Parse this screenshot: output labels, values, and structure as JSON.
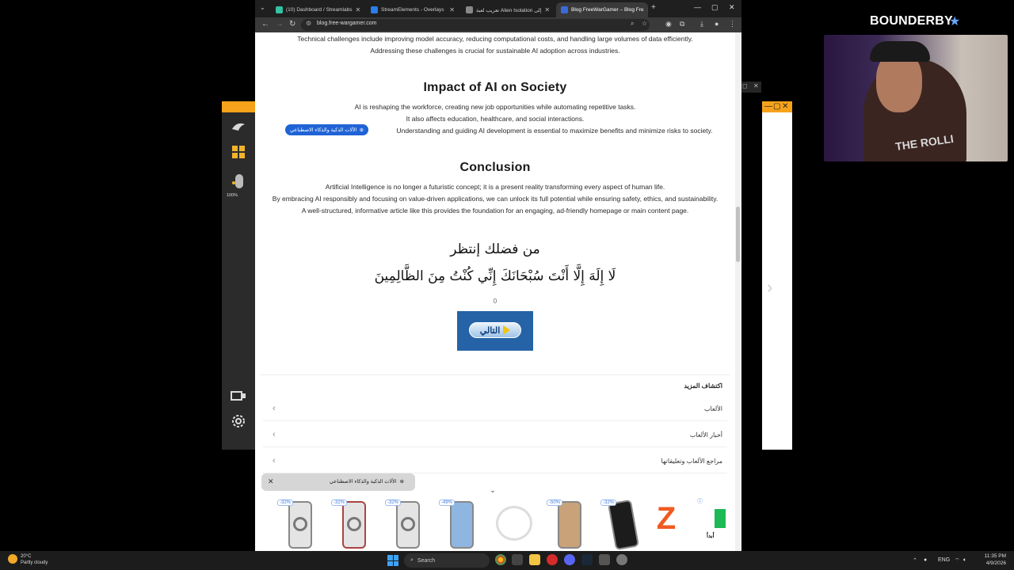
{
  "browser": {
    "tabs": [
      {
        "label": "(10) Dashboard / Streamlabs",
        "fav_color": "#31c3a2"
      },
      {
        "label": "StreamElements - Overlays",
        "fav_color": "#2b7de9"
      },
      {
        "label": "تعريب لعبة Alien Isolation إلى",
        "fav_color": "#888888"
      },
      {
        "label": "Blog FreeWarGamer – Blog Fre",
        "fav_color": "#3b6ad8"
      }
    ],
    "url": "blog.free-wargamer.com"
  },
  "article": {
    "intro_lines": [
      "Technical challenges include improving model accuracy, reducing computational costs, and handling large volumes of data efficiently.",
      "Addressing these challenges is crucial for sustainable AI adoption across industries."
    ],
    "impact_heading": "Impact of AI on Society",
    "impact_lines": [
      "AI is reshaping the workforce, creating new job opportunities while automating repetitive tasks.",
      "It also affects education, healthcare, and social interactions.",
      "Understanding and guiding AI development is essential to maximize benefits and minimize risks to society."
    ],
    "chip_label": "الآلات الذكية والذكاء الاصطناعي",
    "conclusion_heading": "Conclusion",
    "conclusion_lines": [
      "Artificial Intelligence is no longer a futuristic concept; it is a present reality transforming every aspect of human life.",
      "By embracing AI responsibly and focusing on value-driven applications, we can unlock its full potential while ensuring safety, ethics, and sustainability.",
      "A well-structured, informative article like this provides the foundation for an engaging, ad-friendly homepage or main content page."
    ]
  },
  "wait": {
    "please_wait": "من فضلك إنتظر",
    "dua": "لَا إِلَهَ إِلَّا أَنْتَ سُبْحَانَكَ إِنِّي كُنْتُ مِنَ الظَّالِمِينَ",
    "counter": "0",
    "next_label": "التالي"
  },
  "explore": {
    "title": "اكتشاف المزيد",
    "items": [
      "الألعاب",
      "أخبار الألعاب",
      "مراجع الألعاب وتعليقاتها"
    ]
  },
  "bottom_chip": {
    "label": "الآلات الذكية والذكاء الاصطناعي"
  },
  "ads": {
    "discounts": [
      "-32%",
      "-32%",
      "-32%",
      "-49%",
      "",
      "-50%",
      "-32%"
    ],
    "more_label": "أبدأ"
  },
  "left_panel": {
    "battery": "100%"
  },
  "streamer": {
    "name": "BOUNDERBY",
    "shirt": "THE ROLLI"
  },
  "taskbar": {
    "weather_temp": "20°C",
    "weather_desc": "Partly cloudy",
    "search_placeholder": "Search",
    "lang": "ENG",
    "time": "11:35 PM",
    "date": "4/9/2026"
  }
}
